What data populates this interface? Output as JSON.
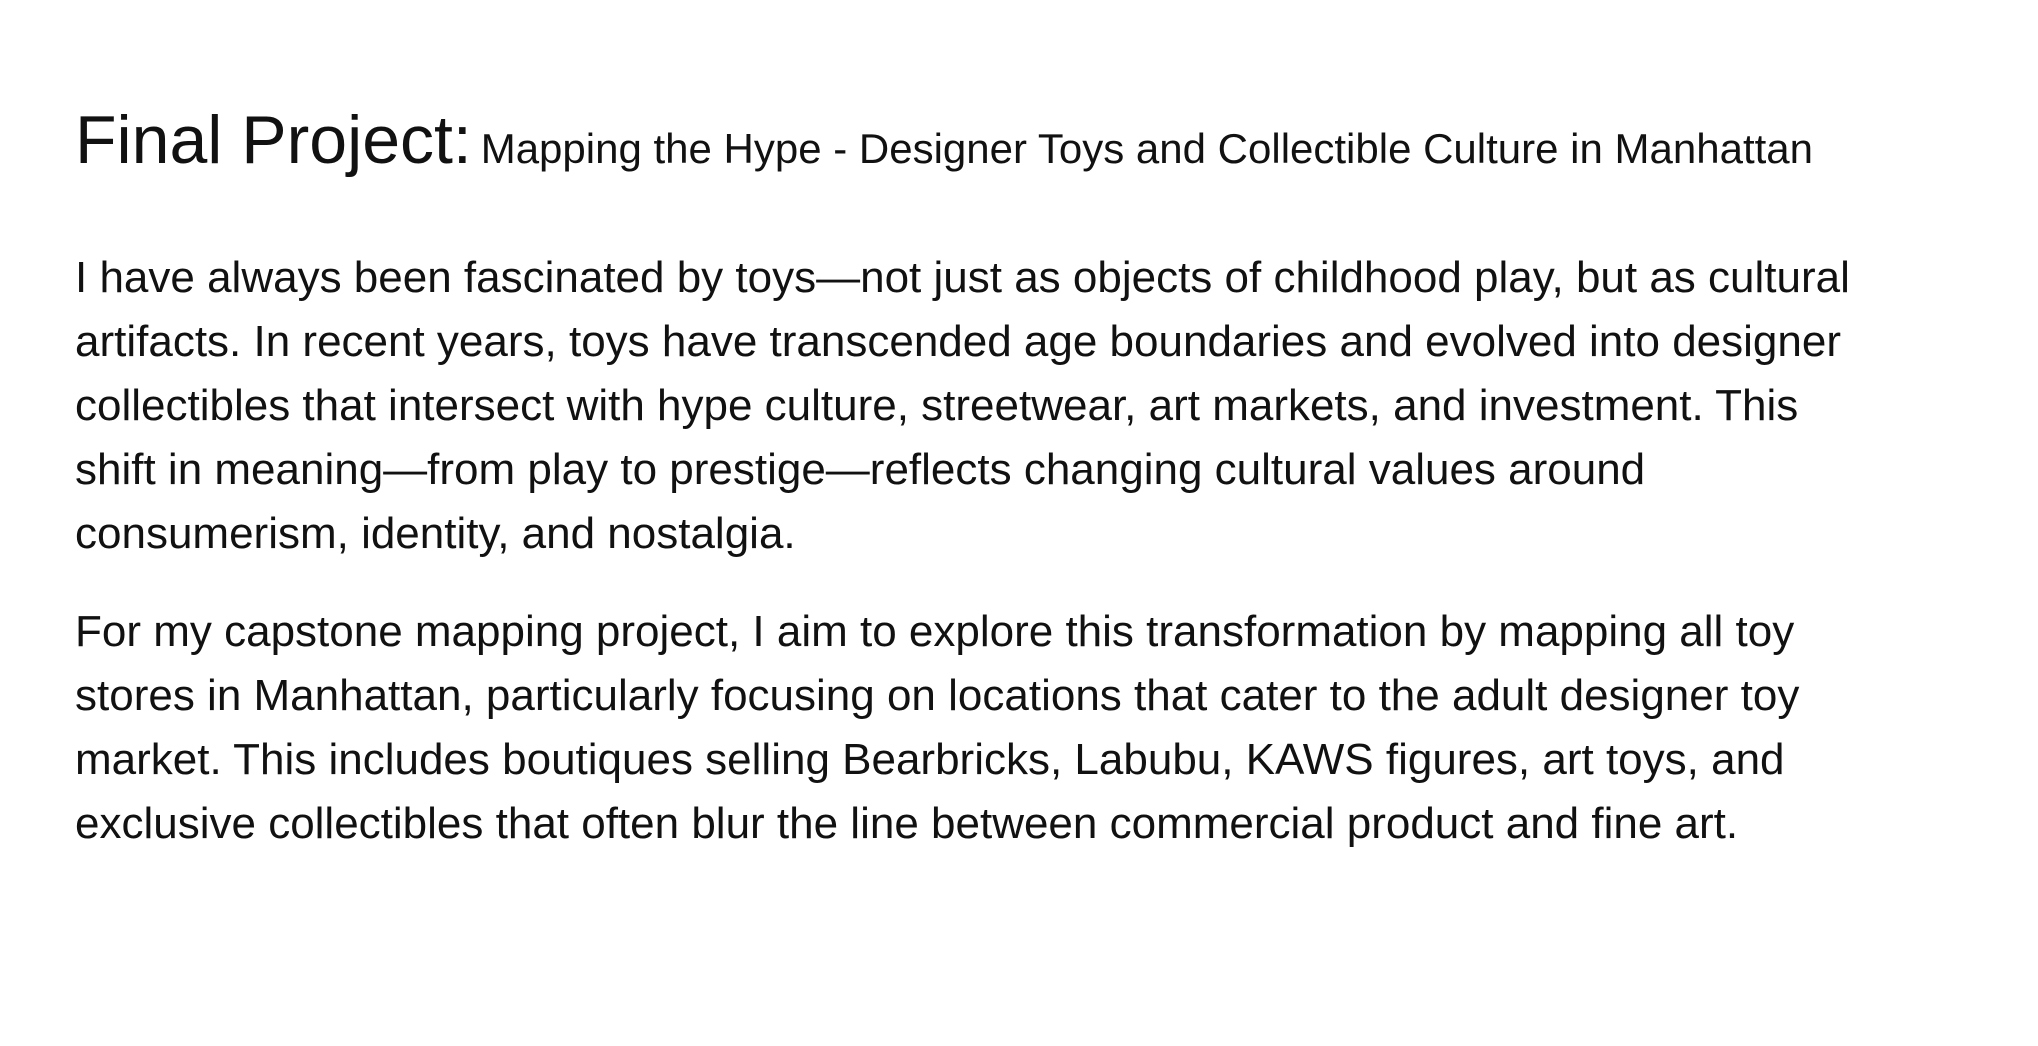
{
  "document": {
    "title": {
      "main": "Final Project:",
      "subtitle": "Mapping the Hype - Designer Toys and Collectible Culture in Manhattan"
    },
    "paragraphs": [
      {
        "lines": [
          "I have always been fascinated by toys—not just as objects of childhood play, but as cultural",
          "artifacts. In recent years, toys have transcended age boundaries and evolved into designer",
          "collectibles that intersect with hype culture, streetwear, art markets, and investment. This",
          "shift in meaning—from play to prestige—reflects changing cultural values around",
          "consumerism, identity, and nostalgia."
        ]
      },
      {
        "lines": [
          "For my capstone mapping project, I aim to explore this transformation by mapping all toy",
          "stores in Manhattan, particularly focusing on locations that cater to the adult designer toy",
          "market. This includes boutiques selling Bearbricks, Labubu, KAWS figures, art toys, and",
          "exclusive collectibles that often blur the line between commercial product and fine art."
        ]
      }
    ]
  }
}
